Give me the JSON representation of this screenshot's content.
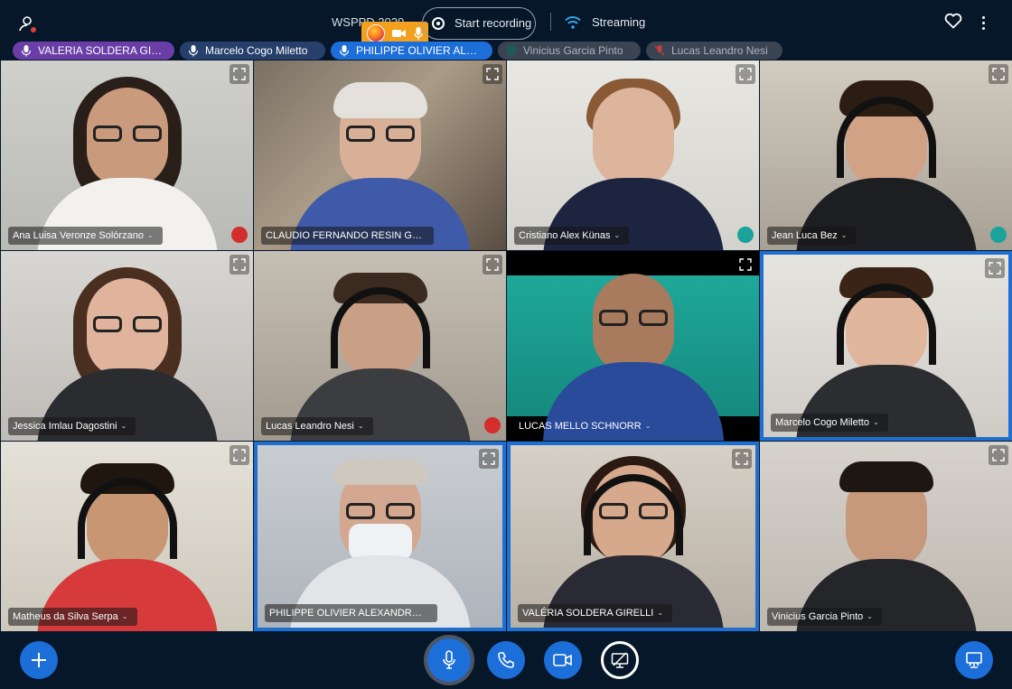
{
  "header": {
    "title": "WSPPD 2020",
    "record_label": "Start recording",
    "streaming_label": "Streaming"
  },
  "talkers": [
    {
      "name": "VALERIA SOLDERA GI…",
      "color": "#6a3ea6",
      "state": "talking"
    },
    {
      "name": "Marcelo Cogo Miletto",
      "color": "#263f6b",
      "state": "talking"
    },
    {
      "name": "PHILIPPE OLIVIER AL…",
      "color": "#1c6ed8",
      "state": "talking"
    },
    {
      "name": "Vinicius Garcia Pinto",
      "color": "#3a4452",
      "state": "muted-listen"
    },
    {
      "name": "Lucas Leandro Nesi",
      "color": "#3a4452",
      "state": "muted"
    }
  ],
  "tiles": [
    {
      "name": "Ana Luisa Veronze Solórzano",
      "status": "muted"
    },
    {
      "name": "CLAUDIO FERNANDO RESIN GEYER",
      "status": ""
    },
    {
      "name": "Cristiano Alex Künas",
      "status": "listen"
    },
    {
      "name": "Jean Luca Bez",
      "status": "listen"
    },
    {
      "name": "Jessica Imlau Dagostini",
      "status": ""
    },
    {
      "name": "Lucas Leandro Nesi",
      "status": "muted"
    },
    {
      "name": "LUCAS MELLO SCHNORR",
      "status": ""
    },
    {
      "name": "Marcelo Cogo Miletto",
      "status": ""
    },
    {
      "name": "Matheus da Silva Serpa",
      "status": ""
    },
    {
      "name": "PHILIPPE OLIVIER ALEXANDRE N…",
      "status": ""
    },
    {
      "name": "VALÉRIA SOLDERA GIRELLI",
      "status": ""
    },
    {
      "name": "Vinicius Garcia Pinto",
      "status": ""
    }
  ],
  "colors": {
    "accent": "#1c6ed8",
    "background": "#06172a",
    "muted_red": "#d32d2d",
    "listen_teal": "#1aa39a",
    "share_orange": "#f2a01e"
  },
  "icons": {
    "user": "user-icon",
    "heart": "heart-icon",
    "more": "more-vertical-icon",
    "mic": "microphone-icon",
    "phone": "phone-icon",
    "camera": "video-camera-icon",
    "screen": "screen-share-icon",
    "plus": "plus-icon",
    "presentation": "presentation-icon",
    "expand": "fullscreen-icon"
  }
}
